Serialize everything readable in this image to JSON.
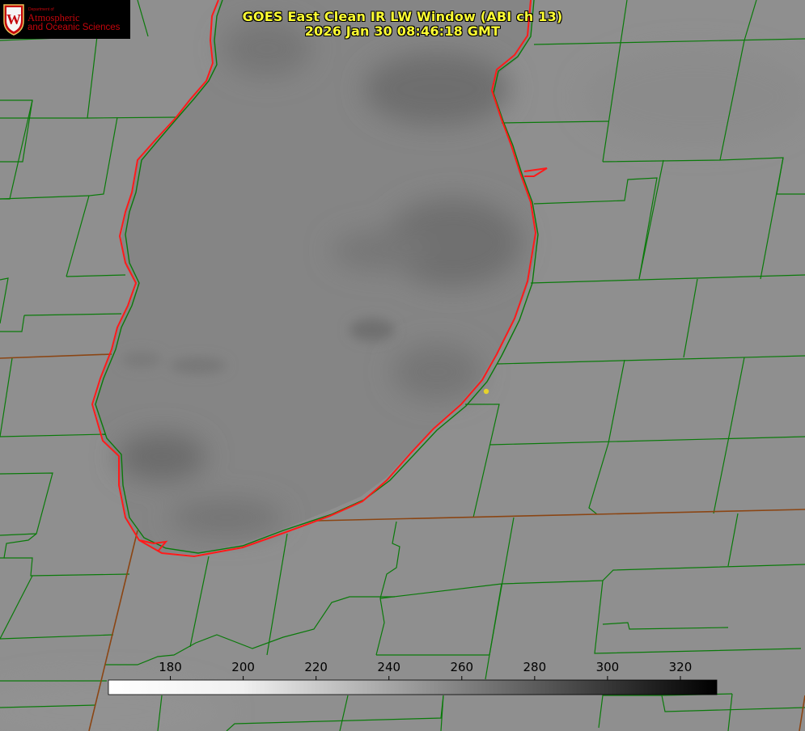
{
  "header": {
    "title_line1": "GOES East Clean IR LW Window (ABI ch 13)",
    "title_line2": "2026 Jan 30 08:46:18 GMT"
  },
  "logo": {
    "dept_text": "Department of",
    "line1": "Atmospheric",
    "line2": "and Oceanic Sciences",
    "seal_letter": "W"
  },
  "colorbar": {
    "ticks": [
      {
        "value": 180,
        "label": "180"
      },
      {
        "value": 200,
        "label": "200"
      },
      {
        "value": 220,
        "label": "220"
      },
      {
        "value": 240,
        "label": "240"
      },
      {
        "value": 260,
        "label": "260"
      },
      {
        "value": 280,
        "label": "280"
      },
      {
        "value": 300,
        "label": "300"
      },
      {
        "value": 320,
        "label": "320"
      }
    ],
    "min": 163,
    "max": 330,
    "color_low": "#ffffff",
    "color_high": "#000000"
  },
  "colors": {
    "land": "#8f8f8f",
    "lake": "#858585",
    "county_lines": "#0a7a0a",
    "state_lines": "#8b4513",
    "lake_outline": "#ff1a1a",
    "title_text": "#ffff33",
    "station_dot": "#e6d22a",
    "logo_red": "#c5050c"
  }
}
